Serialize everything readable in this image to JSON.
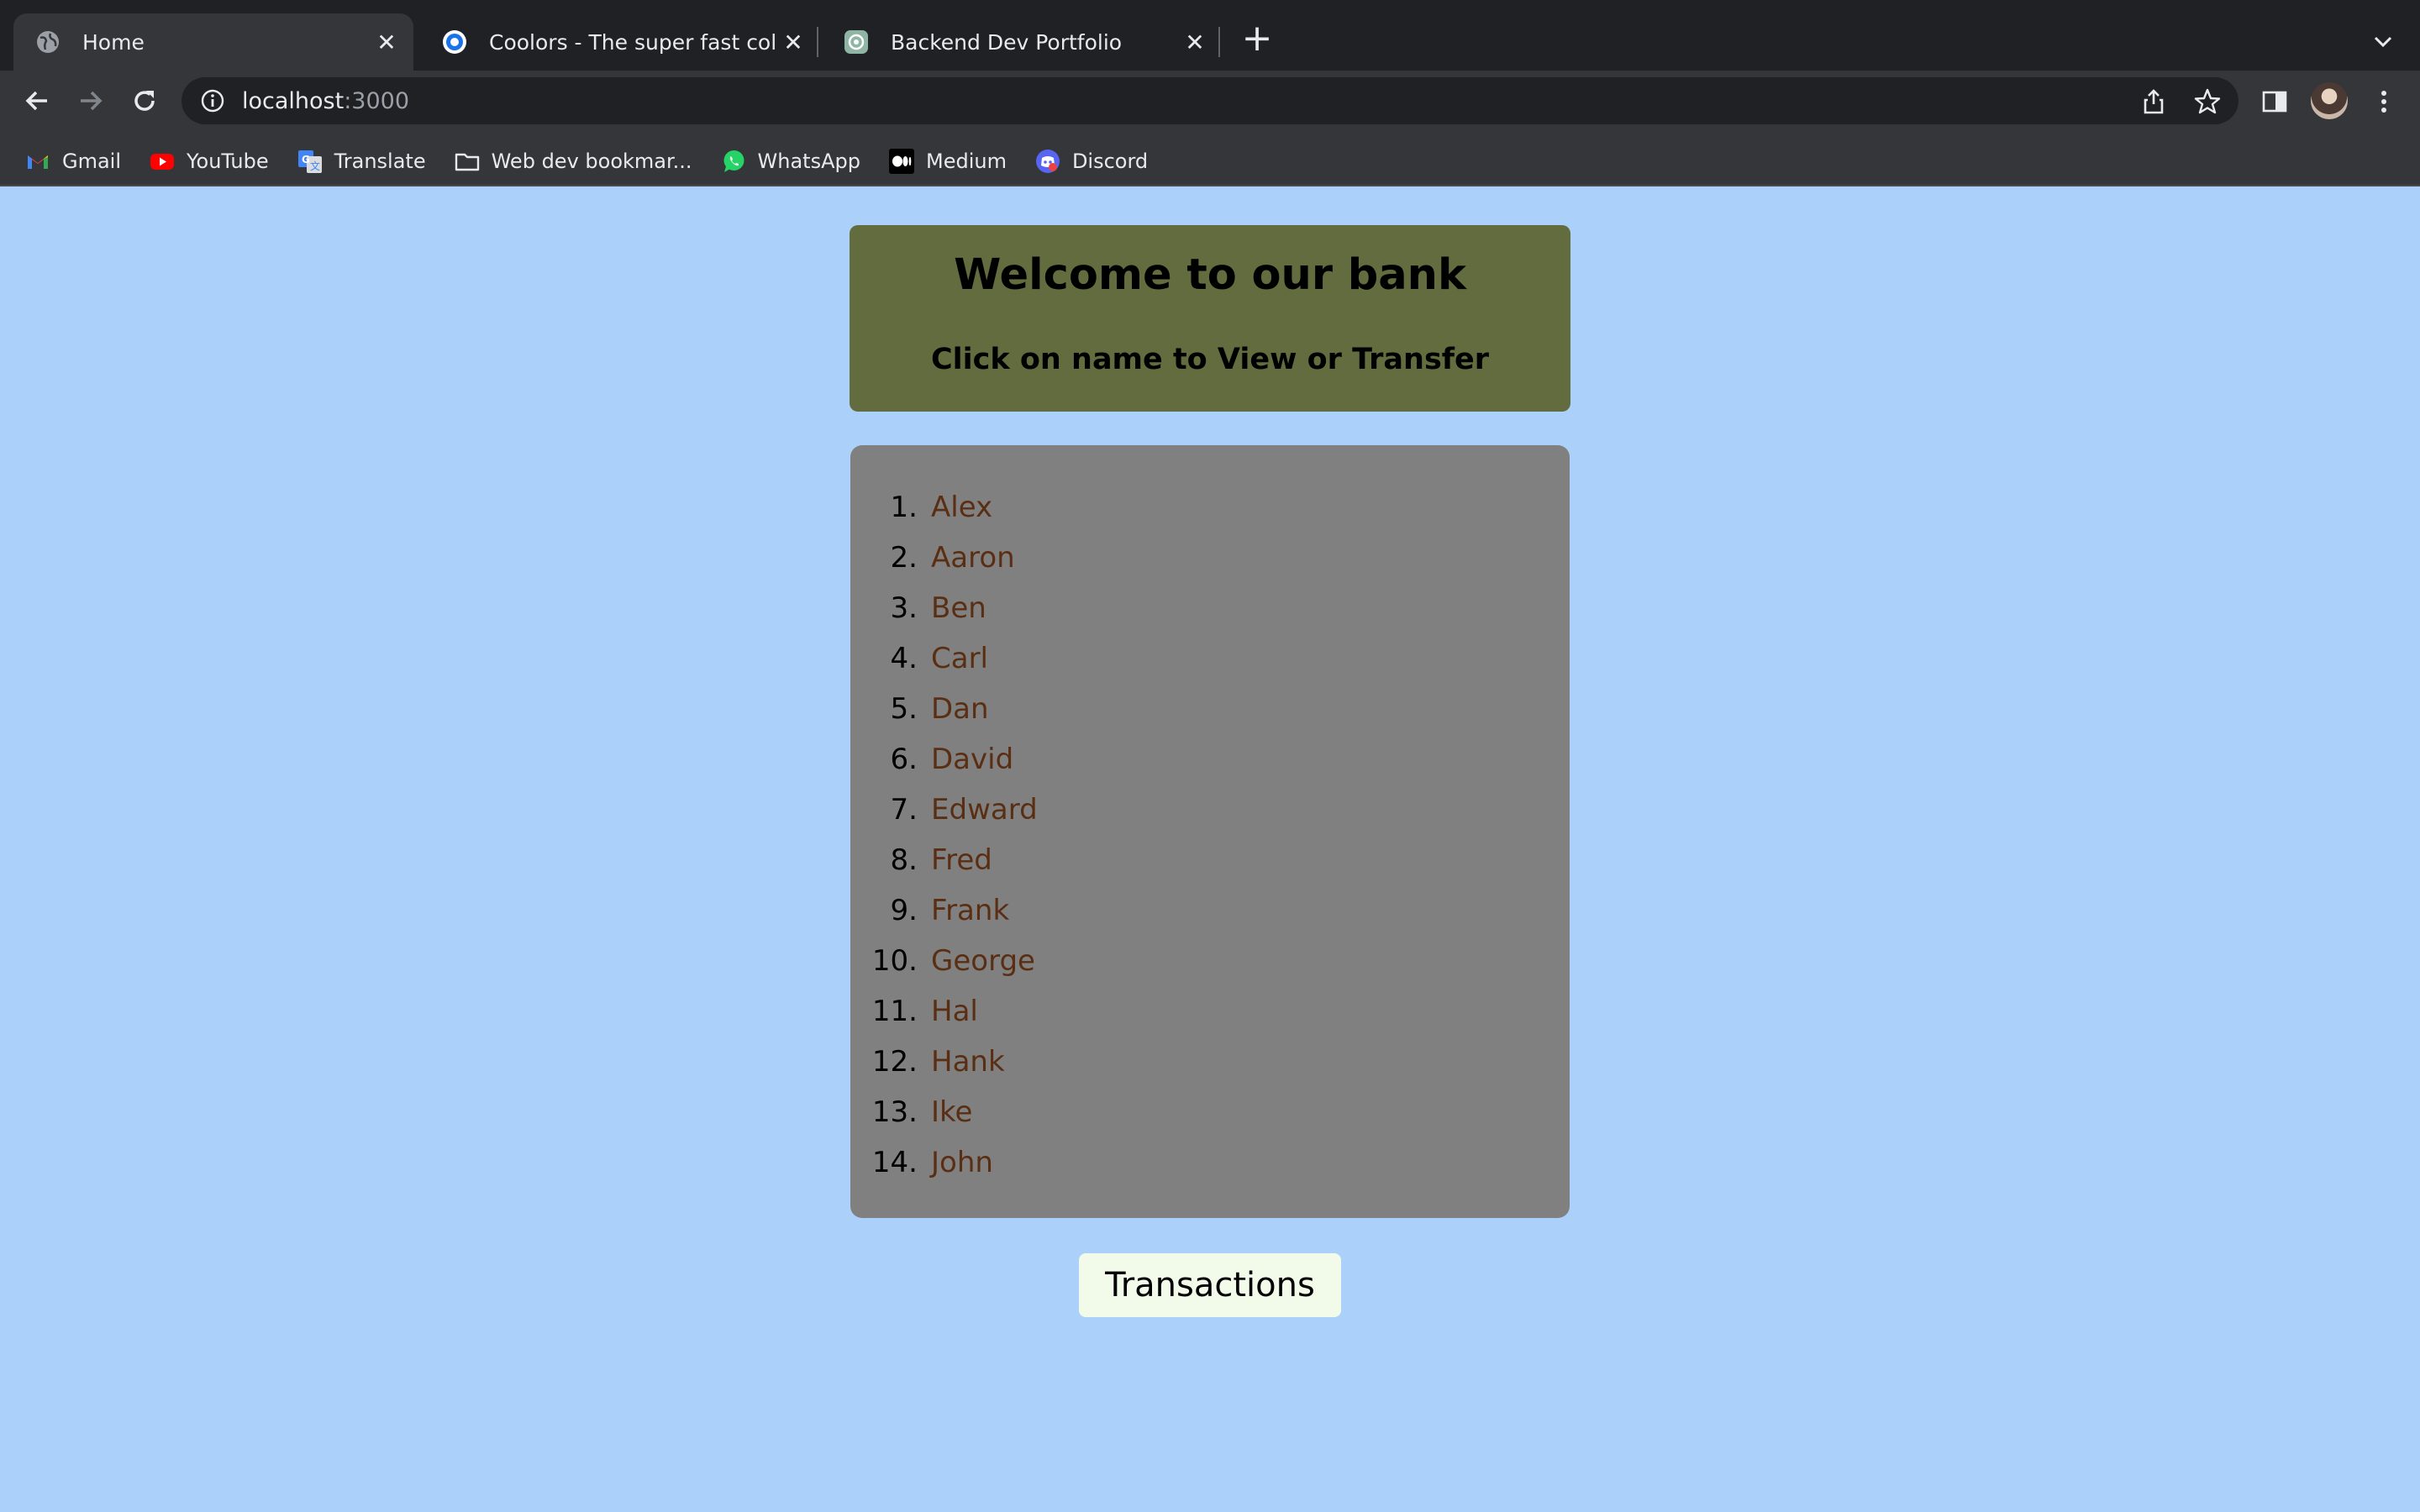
{
  "browser": {
    "tabs": [
      {
        "title": "Home",
        "active": true,
        "favicon": "globe-icon"
      },
      {
        "title": "Coolors - The super fast color p",
        "active": false,
        "favicon": "coolors-icon"
      },
      {
        "title": "Backend Dev Portfolio",
        "active": false,
        "favicon": "openai-icon"
      }
    ],
    "address": {
      "host": "localhost",
      "port": ":3000"
    },
    "bookmarks": [
      {
        "label": "Gmail",
        "icon": "gmail-icon"
      },
      {
        "label": "YouTube",
        "icon": "youtube-icon"
      },
      {
        "label": "Translate",
        "icon": "translate-icon"
      },
      {
        "label": "Web dev bookmar...",
        "icon": "folder-icon"
      },
      {
        "label": "WhatsApp",
        "icon": "whatsapp-icon"
      },
      {
        "label": "Medium",
        "icon": "medium-icon"
      },
      {
        "label": "Discord",
        "icon": "discord-icon"
      }
    ]
  },
  "page": {
    "title": "Welcome to our bank",
    "subtitle": "Click on name to View or Transfer",
    "customers": [
      {
        "num": "1.",
        "name": "Alex"
      },
      {
        "num": "2.",
        "name": "Aaron"
      },
      {
        "num": "3.",
        "name": "Ben"
      },
      {
        "num": "4.",
        "name": "Carl"
      },
      {
        "num": "5.",
        "name": "Dan"
      },
      {
        "num": "6.",
        "name": "David"
      },
      {
        "num": "7.",
        "name": "Edward"
      },
      {
        "num": "8.",
        "name": "Fred"
      },
      {
        "num": "9.",
        "name": "Frank"
      },
      {
        "num": "10.",
        "name": "George"
      },
      {
        "num": "11.",
        "name": "Hal"
      },
      {
        "num": "12.",
        "name": "Hank"
      },
      {
        "num": "13.",
        "name": "Ike"
      },
      {
        "num": "14.",
        "name": "John"
      }
    ],
    "transactions_label": "Transactions"
  },
  "colors": {
    "page_bg": "#ABD0FA",
    "header_bg": "#636C3E",
    "list_bg": "#808080",
    "link": "#5A2E12",
    "button_bg": "#F2FBEA"
  }
}
